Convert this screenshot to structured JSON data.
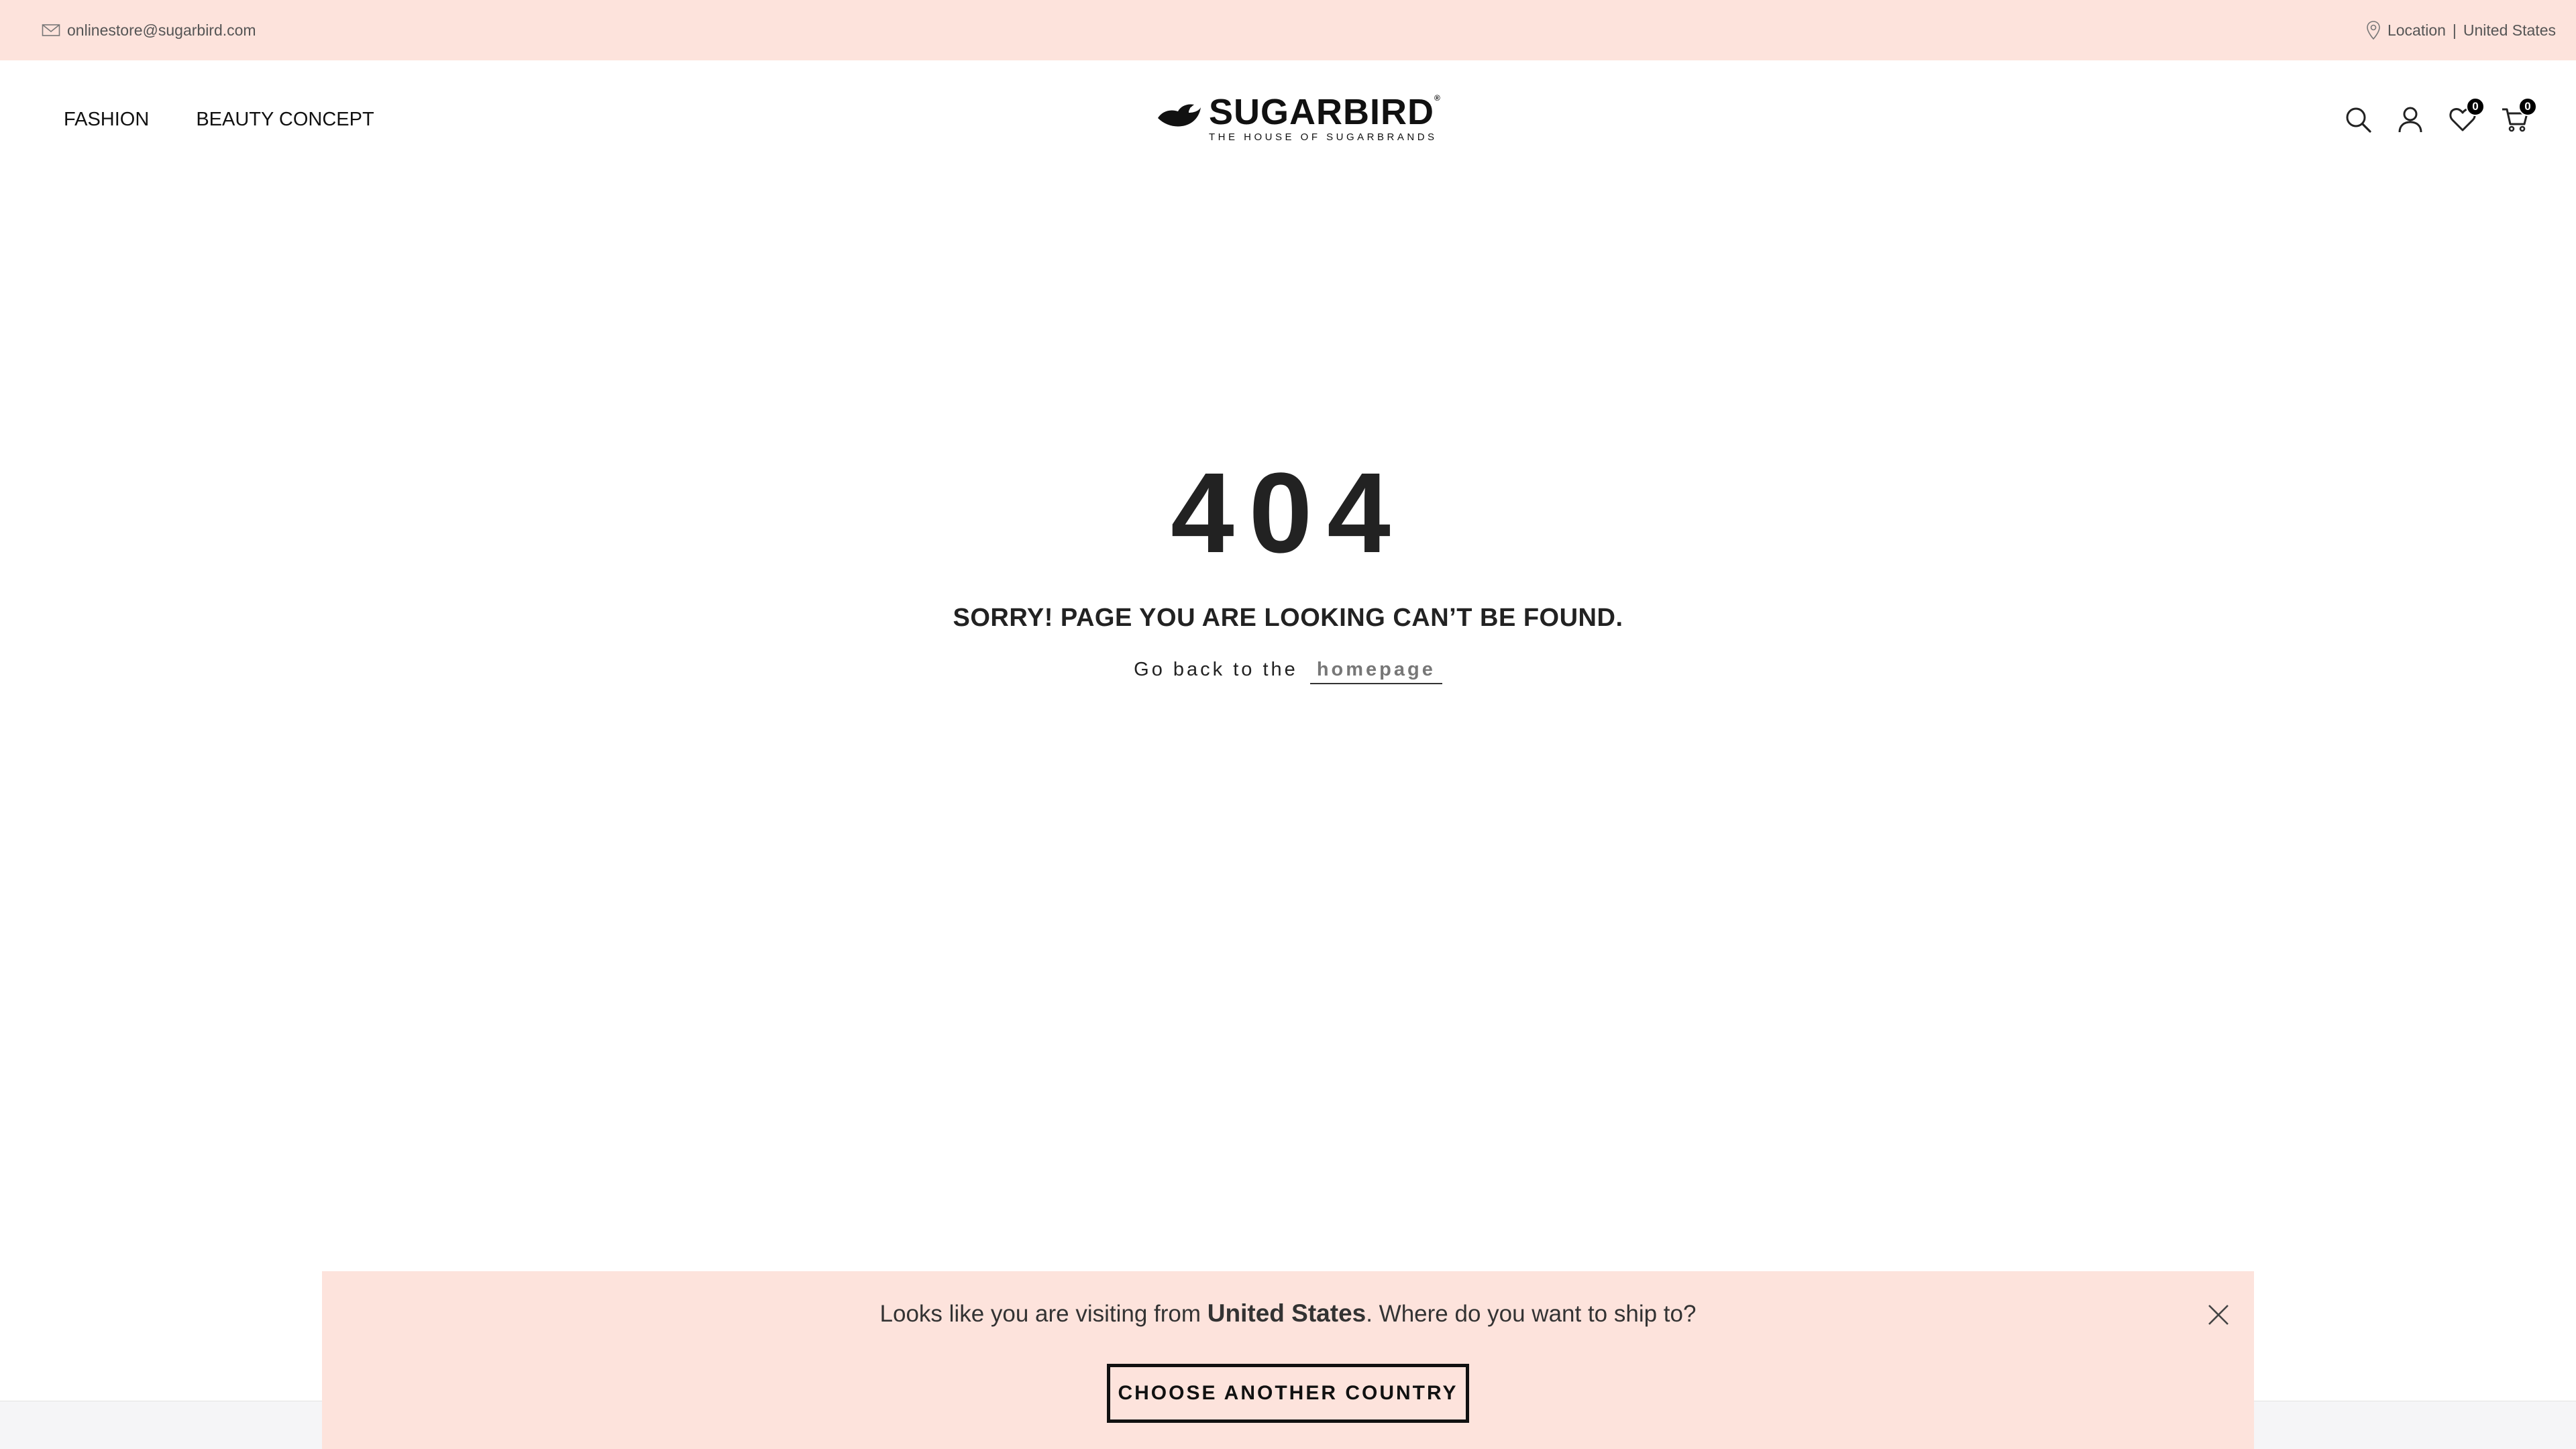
{
  "topbar": {
    "email": "onlinestore@sugarbird.com",
    "location_label": "Location",
    "location_sep": "|",
    "location_value": "United States"
  },
  "nav": {
    "items": [
      {
        "label": "FASHION"
      },
      {
        "label": "BEAUTY CONCEPT"
      }
    ]
  },
  "logo": {
    "brand": "SUGARBIRD",
    "trademark": "®",
    "tagline": "THE HOUSE OF SUGARBRANDS"
  },
  "header_icons": {
    "wishlist_count": "0",
    "cart_count": "0"
  },
  "error": {
    "code": "404",
    "message": "SORRY! PAGE YOU ARE LOOKING CAN’T BE FOUND.",
    "back_text": "Go back to the",
    "back_link": "homepage"
  },
  "geo_popup": {
    "msg_prefix": "Looks like you are visiting from",
    "country": "United States",
    "msg_suffix": ". Where do you want to ship to?",
    "button_label": "CHOOSE ANOTHER COUNTRY"
  },
  "colors": {
    "accent_bg": "#fde3dc",
    "text": "#222222",
    "badge": "#000000"
  }
}
